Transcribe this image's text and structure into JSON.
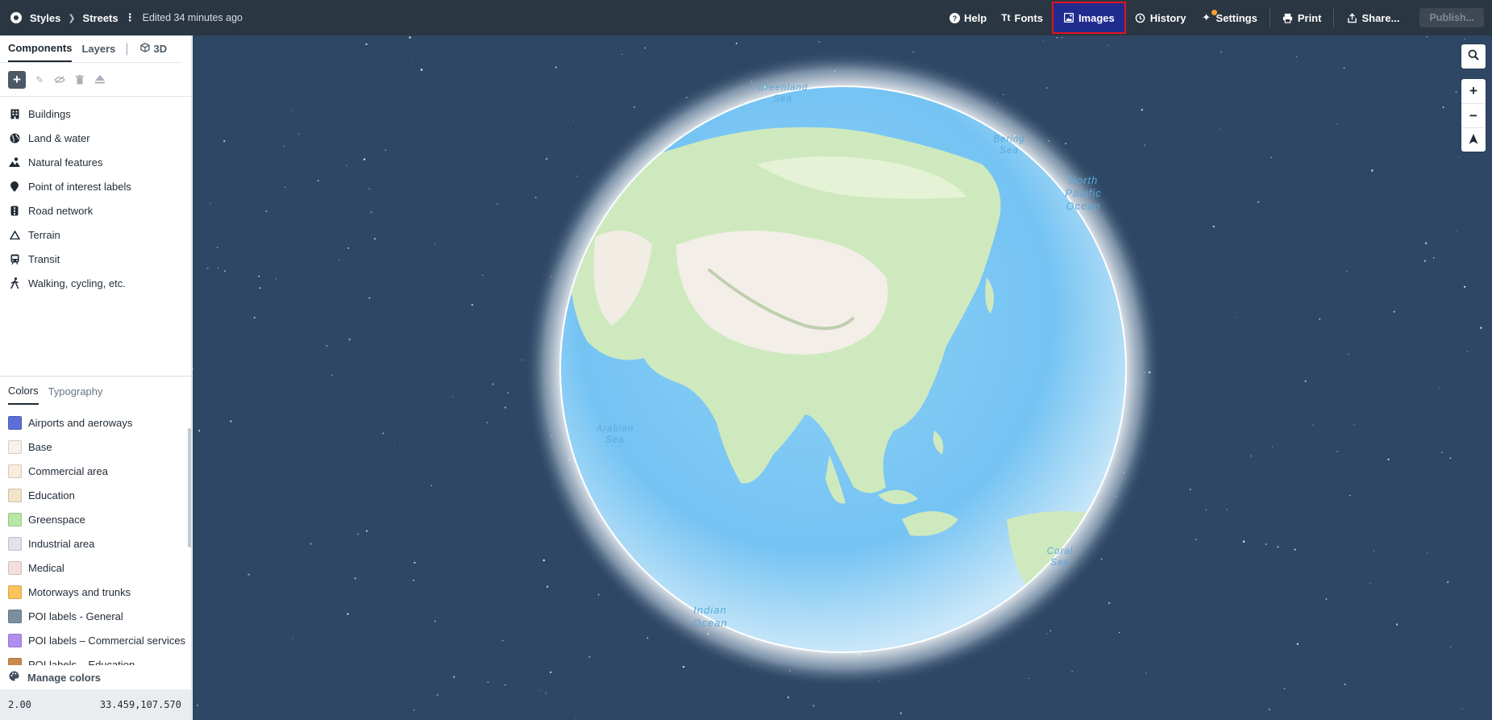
{
  "topbar": {
    "breadcrumb": {
      "root": "Styles",
      "current": "Streets",
      "menu": "⋮"
    },
    "edited": "Edited 34 minutes ago",
    "buttons": {
      "help": "Help",
      "fonts": "Fonts",
      "images": "Images",
      "history": "History",
      "settings": "Settings",
      "print": "Print",
      "share": "Share...",
      "publish": "Publish..."
    }
  },
  "sidebar": {
    "tabs": {
      "components": "Components",
      "layers": "Layers",
      "three_d": "3D"
    },
    "components": [
      {
        "label": "Buildings",
        "icon": "building-icon"
      },
      {
        "label": "Land & water",
        "icon": "globe-icon"
      },
      {
        "label": "Natural features",
        "icon": "natural-features-icon"
      },
      {
        "label": "Point of interest labels",
        "icon": "pin-icon"
      },
      {
        "label": "Road network",
        "icon": "road-icon"
      },
      {
        "label": "Terrain",
        "icon": "mountain-icon"
      },
      {
        "label": "Transit",
        "icon": "transit-icon"
      },
      {
        "label": "Walking, cycling, etc.",
        "icon": "walking-icon"
      }
    ],
    "color_tabs": {
      "colors": "Colors",
      "typography": "Typography"
    },
    "colors": [
      {
        "label": "Airports and aeroways",
        "color": "#5b6fd6"
      },
      {
        "label": "Base",
        "color": "#f7f1ec"
      },
      {
        "label": "Commercial area",
        "color": "#f9ecdd"
      },
      {
        "label": "Education",
        "color": "#f2e3c9"
      },
      {
        "label": "Greenspace",
        "color": "#b8e6a6"
      },
      {
        "label": "Industrial area",
        "color": "#e1e3ec"
      },
      {
        "label": "Medical",
        "color": "#f5dede"
      },
      {
        "label": "Motorways and trunks",
        "color": "#fbc35a"
      },
      {
        "label": "POI labels - General",
        "color": "#7a8ea0"
      },
      {
        "label": "POI labels – Commercial services",
        "color": "#b08ef0"
      },
      {
        "label": "POI labels – Education",
        "color": "#c98a4b"
      }
    ],
    "manage_colors": "Manage colors",
    "status": {
      "zoom": "2.00",
      "coords": "33.459,107.570"
    }
  },
  "map": {
    "labels": {
      "greenland_sea": [
        "Greenland",
        "Sea"
      ],
      "bering_sea": [
        "Bering",
        "Sea"
      ],
      "north_pacific": [
        "North",
        "Pacific",
        "Ocean"
      ],
      "arabian_sea": [
        "Arabian",
        "Sea"
      ],
      "indian_ocean": [
        "Indian",
        "Ocean"
      ],
      "coral_sea": [
        "Coral",
        "Sea"
      ]
    },
    "controls": {
      "search": "search-icon",
      "zoom_in": "+",
      "zoom_out": "−",
      "compass": "compass-icon"
    }
  },
  "colors": {
    "topbar_bg": "#2a3642",
    "map_bg": "#2d4765",
    "highlight": "#e0141e",
    "active_btn": "#1f2c8e"
  }
}
